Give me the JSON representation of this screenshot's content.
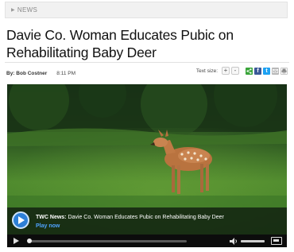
{
  "breadcrumb": {
    "label": "NEWS"
  },
  "article": {
    "title": "Davie Co. Woman Educates Pubic on Rehabilitating Baby Deer",
    "byline": "By: Bob Costner",
    "time": "8:11 PM"
  },
  "tools": {
    "text_size_label": "Text size:",
    "increase": "+",
    "decrease": "-",
    "share_icons": [
      "share-icon",
      "facebook-icon",
      "twitter-icon",
      "email-icon",
      "print-icon"
    ],
    "colors": {
      "share": "#3aa53a",
      "facebook": "#3b5998",
      "twitter": "#1da1f2",
      "email": "#b8b8b8",
      "print": "#9a9a9a"
    }
  },
  "video": {
    "source_label": "TWC News:",
    "caption_title": "Davie Co. Woman Educates Pubic on Rehabilitating Baby Deer",
    "play_now": "Play now",
    "progress": 0.0,
    "colors": {
      "play_button": "#2d7fd6",
      "play_now": "#4fa3ff"
    }
  }
}
